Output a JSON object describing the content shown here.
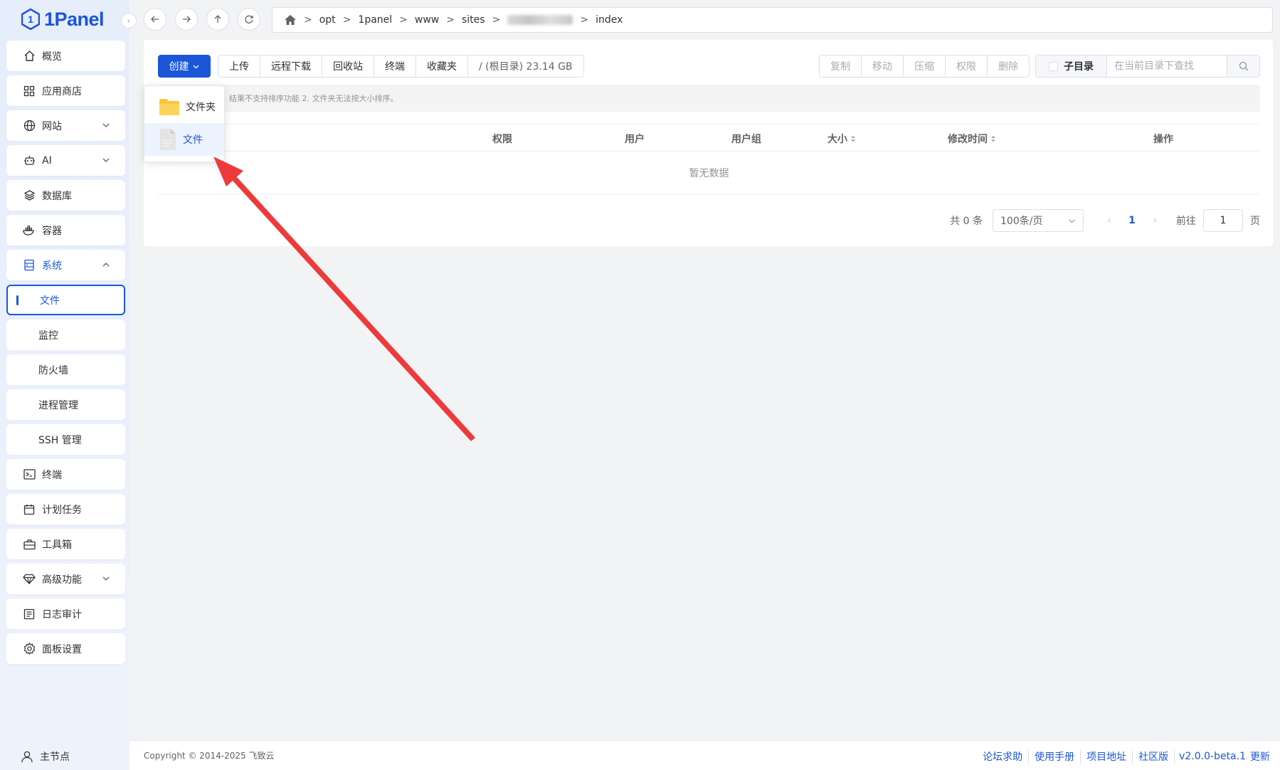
{
  "app": {
    "logo_text": "1Panel"
  },
  "sidebar": {
    "items": [
      {
        "label": "概览",
        "icon": "home-icon"
      },
      {
        "label": "应用商店",
        "icon": "grid-icon"
      },
      {
        "label": "网站",
        "icon": "globe-icon"
      },
      {
        "label": "AI",
        "icon": "robot-icon"
      },
      {
        "label": "数据库",
        "icon": "layers-icon"
      },
      {
        "label": "容器",
        "icon": "docker-icon"
      },
      {
        "label": "系统",
        "icon": "server-icon"
      }
    ],
    "system_children": [
      "文件",
      "监控",
      "防火墙",
      "进程管理",
      "SSH 管理"
    ],
    "items_after": [
      {
        "label": "终端",
        "icon": "terminal-icon"
      },
      {
        "label": "计划任务",
        "icon": "calendar-icon"
      },
      {
        "label": "工具箱",
        "icon": "toolbox-icon"
      },
      {
        "label": "高级功能",
        "icon": "diamond-icon"
      },
      {
        "label": "日志审计",
        "icon": "log-icon"
      },
      {
        "label": "面板设置",
        "icon": "gear-icon"
      }
    ],
    "node_label": "主节点"
  },
  "breadcrumb": {
    "parts": [
      "opt",
      "1panel",
      "www",
      "sites",
      "index"
    ]
  },
  "toolbar": {
    "create_label": "创建",
    "buttons": [
      "上传",
      "远程下载",
      "回收站",
      "终端",
      "收藏夹",
      "/ (根目录) 23.14 GB"
    ],
    "right_buttons": [
      "复制",
      "移动",
      "压缩",
      "权限",
      "删除"
    ],
    "subdir_label": "子目录",
    "search_placeholder": "在当前目录下查找"
  },
  "notice": "结果不支持排序功能 2. 文件夹无法按大小排序。",
  "table": {
    "headers": [
      "权限",
      "用户",
      "用户组",
      "大小",
      "修改时间",
      "操作"
    ],
    "empty_text": "暂无数据"
  },
  "pagination": {
    "total_label": "共 0 条",
    "page_size": "100条/页",
    "current_page": "1",
    "goto_label": "前往",
    "goto_value": "1",
    "page_unit": "页"
  },
  "create_menu": [
    "文件夹",
    "文件"
  ],
  "footer": {
    "copyright": "Copyright © 2014-2025 飞致云",
    "links": [
      "论坛求助",
      "使用手册",
      "项目地址",
      "社区版",
      "v2.0.0-beta.1",
      "更新"
    ]
  },
  "colors": {
    "accent": "#1b56d8",
    "arrow": "#ee3a3a",
    "folder": "#f7c53a"
  }
}
